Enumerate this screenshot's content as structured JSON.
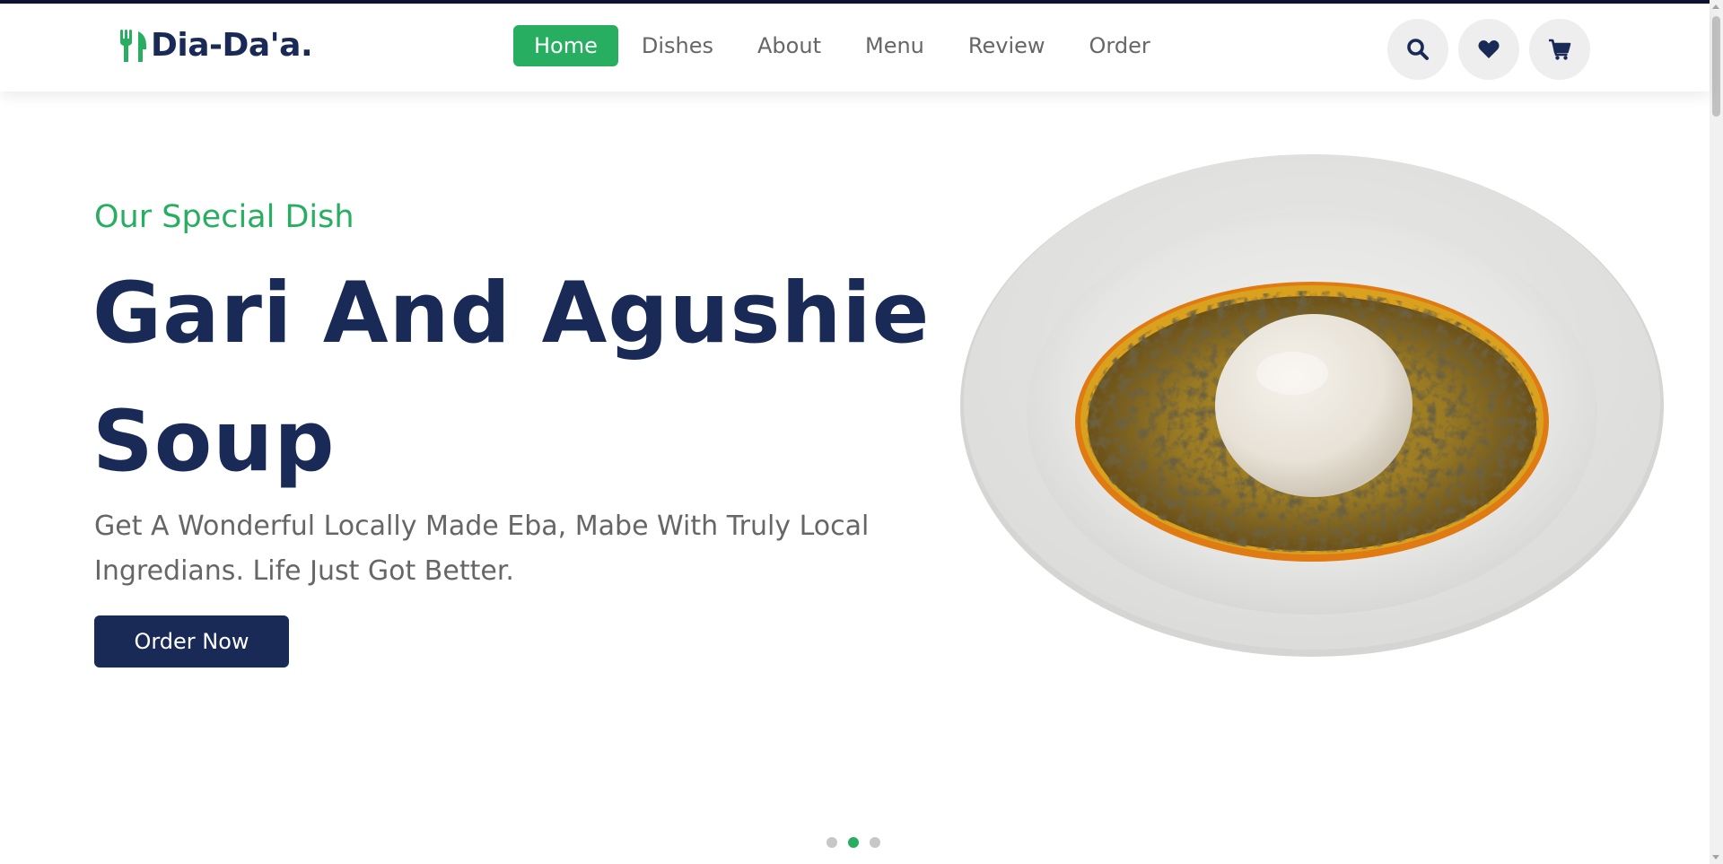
{
  "brand": {
    "name": "Dia-Da'a.",
    "accent": "#27ae60",
    "navy": "#1a2a57"
  },
  "nav": {
    "items": [
      {
        "label": "Home",
        "active": true
      },
      {
        "label": "Dishes",
        "active": false
      },
      {
        "label": "About",
        "active": false
      },
      {
        "label": "Menu",
        "active": false
      },
      {
        "label": "Review",
        "active": false
      },
      {
        "label": "Order",
        "active": false
      }
    ]
  },
  "header_icons": [
    "search-icon",
    "heart-icon",
    "cart-icon"
  ],
  "hero": {
    "subtitle": "Our Special Dish",
    "title": "Gari And Agushie Soup",
    "description": "Get A Wonderful Locally Made Eba, Mabe With Truly Local Ingredians. Life Just Got Better.",
    "cta": "Order Now"
  },
  "slider": {
    "count": 3,
    "active_index": 1
  }
}
